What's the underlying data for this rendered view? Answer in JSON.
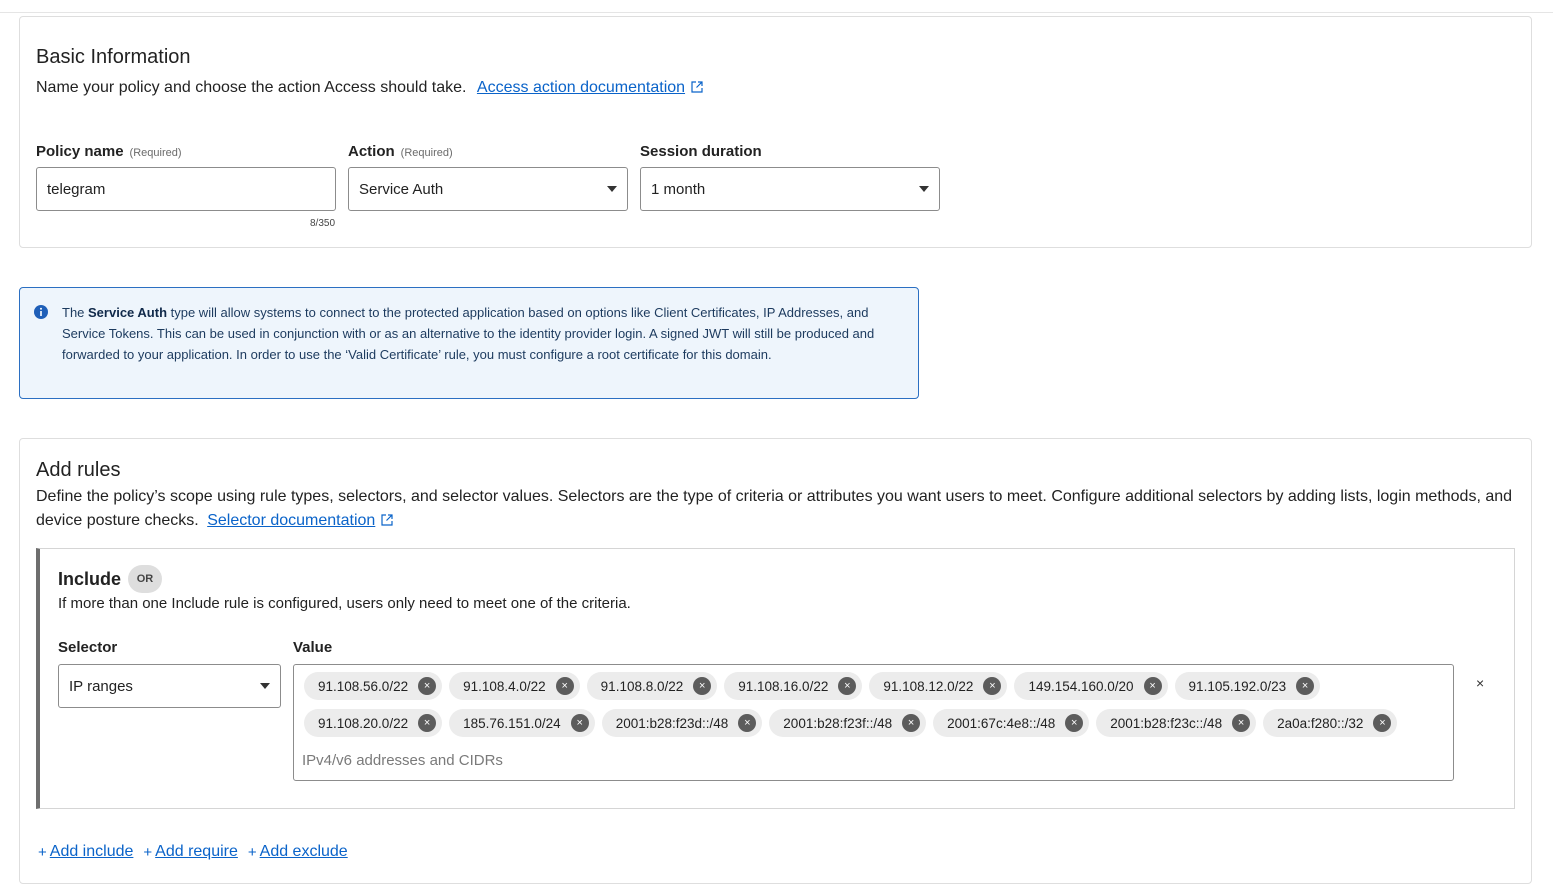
{
  "basic": {
    "title": "Basic Information",
    "description": "Name your policy and choose the action Access should take.",
    "doc_link": "Access action documentation",
    "policy_name": {
      "label": "Policy name",
      "required": "(Required)",
      "value": "telegram",
      "counter": "8/350"
    },
    "action": {
      "label": "Action",
      "required": "(Required)",
      "value": "Service Auth"
    },
    "session": {
      "label": "Session duration",
      "value": "1 month"
    }
  },
  "info": {
    "pre": "The ",
    "bold": "Service Auth",
    "post": " type will allow systems to connect to the protected application based on options like Client Certificates, IP Addresses, and Service Tokens. This can be used in conjunction with or as an alternative to the identity provider login. A signed JWT will still be produced and forwarded to your application. In order to use the ‘Valid Certificate’ rule, you must configure a root certificate for this domain."
  },
  "rules": {
    "title": "Add rules",
    "description": "Define the policy’s scope using rule types, selectors, and selector values. Selectors are the type of criteria or attributes you want users to meet. Configure additional selectors by adding lists, login methods, and device posture checks.",
    "doc_link": "Selector documentation",
    "include": {
      "title": "Include",
      "badge": "OR",
      "description": "If more than one Include rule is configured, users only need to meet one of the criteria.",
      "selector_label": "Selector",
      "selector_value": "IP ranges",
      "value_label": "Value",
      "value_placeholder": "IPv4/v6 addresses and CIDRs",
      "remove_symbol": "×",
      "chip_remove_symbol": "×",
      "values": [
        "91.108.56.0/22",
        "91.108.4.0/22",
        "91.108.8.0/22",
        "91.108.16.0/22",
        "91.108.12.0/22",
        "149.154.160.0/20",
        "91.105.192.0/23",
        "91.108.20.0/22",
        "185.76.151.0/24",
        "2001:b28:f23d::/48",
        "2001:b28:f23f::/48",
        "2001:67c:4e8::/48",
        "2001:b28:f23c::/48",
        "2a0a:f280::/32"
      ]
    },
    "add_include": "Add include",
    "add_require": "Add require",
    "add_exclude": "Add exclude",
    "plus_symbol": "+"
  }
}
